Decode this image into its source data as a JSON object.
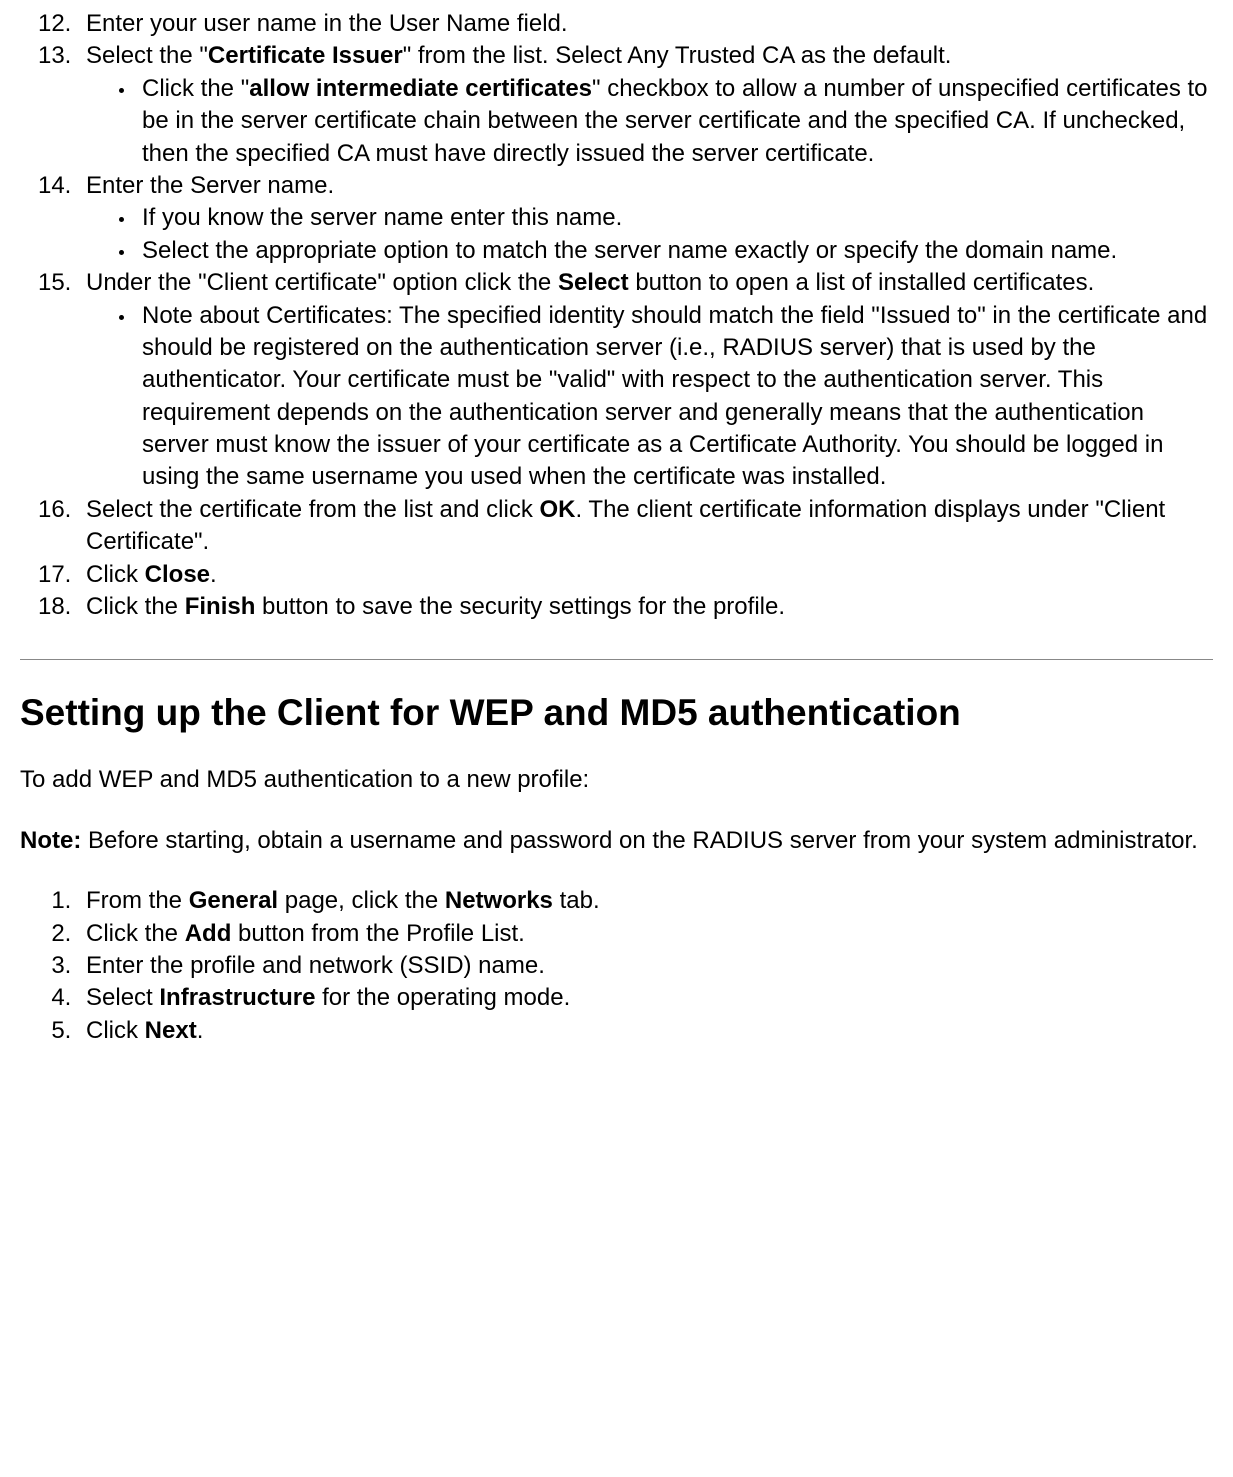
{
  "step12": {
    "text": "Enter your user name in the User Name field."
  },
  "step13": {
    "t1": "Select the \"",
    "b1": "Certificate Issuer",
    "t2": "\" from the list. Select Any Trusted CA as the default.",
    "sub1": {
      "t1": "Click the \"",
      "b1": "allow intermediate certificates",
      "t2": "\" checkbox to allow a number of unspecified certificates to be in the server certificate chain between the server certificate and the specified CA. If unchecked, then the specified CA must have directly issued the server certificate."
    }
  },
  "step14": {
    "text": "Enter the Server name.",
    "sub1": "If you know the server name enter this name.",
    "sub2": "Select the appropriate option to match the server name exactly or specify the domain name."
  },
  "step15": {
    "t1": "Under the \"Client certificate\" option click the ",
    "b1": "Select",
    "t2": " button to open a list of installed certificates.",
    "sub1": "Note about Certificates: The specified identity should match the field \"Issued to\" in the certificate and should be registered on the authentication server (i.e., RADIUS server) that is used by the authenticator. Your certificate must be \"valid\" with respect to the authentication server. This requirement depends on the authentication server and generally means that the authentication server must know the issuer of your certificate as a Certificate Authority. You should be logged in using the same username you used when the certificate was installed."
  },
  "step16": {
    "t1": "Select the certificate from the list and click ",
    "b1": "OK",
    "t2": ". The client certificate information displays under \"Client Certificate\"."
  },
  "step17": {
    "t1": "Click ",
    "b1": "Close",
    "t2": "."
  },
  "step18": {
    "t1": "Click the ",
    "b1": "Finish",
    "t2": " button to save the security settings for the profile."
  },
  "section2": {
    "heading": "Setting up the Client for WEP and MD5 authentication",
    "intro": "To add WEP and MD5 authentication to a new profile:",
    "note_label": "Note:",
    "note_text": " Before starting, obtain a username and password on the RADIUS server from your system administrator.",
    "s1": {
      "t1": "From the ",
      "b1": "General",
      "t2": " page, click the ",
      "b2": "Networks",
      "t3": " tab."
    },
    "s2": {
      "t1": "Click the ",
      "b1": "Add",
      "t2": " button from the Profile List."
    },
    "s3": {
      "text": "Enter the profile and network (SSID) name."
    },
    "s4": {
      "t1": "Select ",
      "b1": "Infrastructure",
      "t2": " for the operating mode."
    },
    "s5": {
      "t1": "Click ",
      "b1": "Next",
      "t2": "."
    }
  }
}
